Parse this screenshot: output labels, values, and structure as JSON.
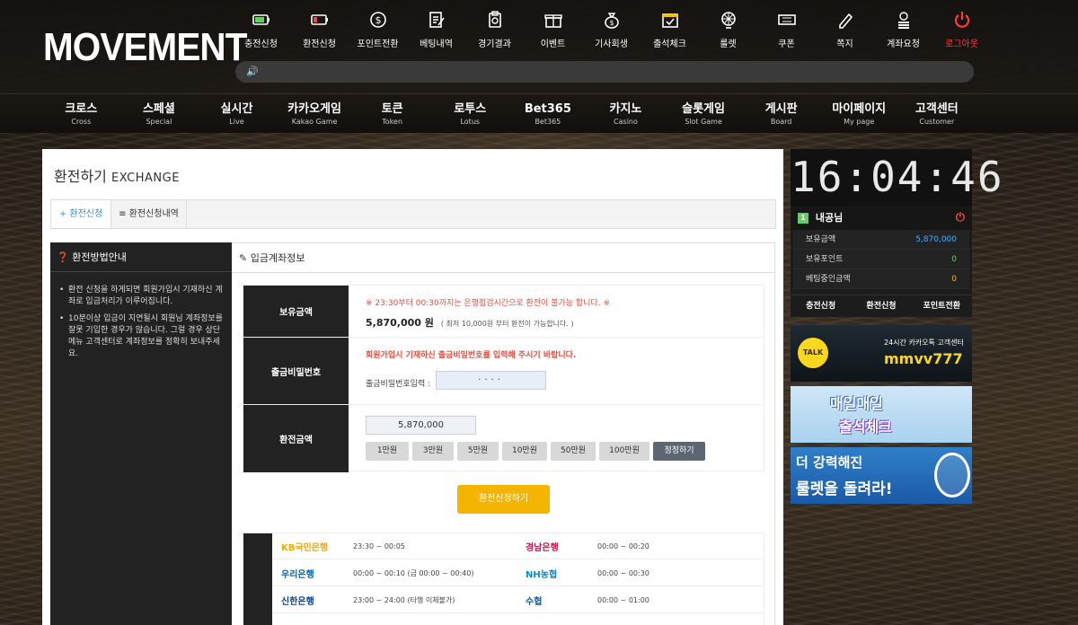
{
  "logo": "MOVEMENT",
  "top_menu": [
    {
      "label": "충전신청",
      "icon": "battery-charge-icon"
    },
    {
      "label": "환전신청",
      "icon": "battery-low-icon"
    },
    {
      "label": "포인트전환",
      "icon": "dollar-convert-icon"
    },
    {
      "label": "베팅내역",
      "icon": "edit-doc-icon"
    },
    {
      "label": "경기결과",
      "icon": "clipboard-icon"
    },
    {
      "label": "이벤트",
      "icon": "gift-icon"
    },
    {
      "label": "기사회생",
      "icon": "money-bag-icon"
    },
    {
      "label": "출석체크",
      "icon": "calendar-check-icon"
    },
    {
      "label": "룰렛",
      "icon": "roulette-icon"
    },
    {
      "label": "쿠폰",
      "icon": "ticket-icon"
    },
    {
      "label": "쪽지",
      "icon": "pen-note-icon"
    },
    {
      "label": "계좌요청",
      "icon": "coins-icon"
    },
    {
      "label": "로그아웃",
      "icon": "power-icon"
    }
  ],
  "notice_icon": "speaker-icon",
  "main_nav": [
    {
      "ko": "크로스",
      "en": "Cross"
    },
    {
      "ko": "스페셜",
      "en": "Special"
    },
    {
      "ko": "실시간",
      "en": "Live"
    },
    {
      "ko": "카카오게임",
      "en": "Kakao Game"
    },
    {
      "ko": "토큰",
      "en": "Token"
    },
    {
      "ko": "로투스",
      "en": "Lotus"
    },
    {
      "ko": "Bet365",
      "en": "Bet365"
    },
    {
      "ko": "카지노",
      "en": "Casino"
    },
    {
      "ko": "슬롯게임",
      "en": "Slot Game"
    },
    {
      "ko": "게시판",
      "en": "Board"
    },
    {
      "ko": "마이페이지",
      "en": "My page"
    },
    {
      "ko": "고객센터",
      "en": "Customer"
    }
  ],
  "page": {
    "title": "환전하기",
    "title_en": "EXCHANGE",
    "tabs": [
      "+ 환전신청",
      "≡ 환전신청내역"
    ]
  },
  "guide": {
    "title": "환전방법안내",
    "items": [
      "환전 신청을 하게되면 회원가입시 기재하신 계좌로 입금처리가 이루어집니다.",
      "10분이상 입금이 지연될시 회원님 계좌정보를 잘못 기입한 경우가 많습니다. 그럴 경우 상단메뉴 고객센터로 계좌정보를 정확히 보내주세요."
    ]
  },
  "info": {
    "title": "입금계좌정보",
    "balance_label": "보유금액",
    "warning": "※ 23:30부터 00:30까지는 은행점검시간으로 환전이 불가능 합니다. ※",
    "balance_value": "5,870,000 원",
    "balance_note": "( 최저 10,000원 부터 환전이 가능합니다. )",
    "password_label": "출금비밀번호",
    "password_warning": "회원가입시 기재하신 출금비밀번호를 입력해 주시기 바랍니다.",
    "password_input_label": "출금비밀번호입력 :",
    "password_value": "····",
    "amount_label": "환전금액",
    "amount_value": "5,870,000",
    "quick_buttons": [
      "1만원",
      "3만원",
      "5만원",
      "10만원",
      "50만원",
      "100만원",
      "정정하기"
    ],
    "submit": "환전신청하기"
  },
  "banks": [
    [
      {
        "name": "KB국민은행",
        "time": "23:30 ~ 00:05",
        "color": "#f2a900"
      },
      {
        "name": "경남은행",
        "time": "00:00 ~ 00:20",
        "color": "#d6114b"
      }
    ],
    [
      {
        "name": "우리은행",
        "time": "00:00 ~ 00:10 (금 00:00 ~ 00:40)",
        "color": "#0068b7"
      },
      {
        "name": "NH농협",
        "time": "00:00 ~ 00:30",
        "color": "#0a8bd6"
      }
    ],
    [
      {
        "name": "신한은행",
        "time": "23:00 ~ 24:00 (타행 이체불가)",
        "color": "#0046a0"
      },
      {
        "name": "수협",
        "time": "00:00 ~ 01:00",
        "color": "#0a5fb4"
      }
    ]
  ],
  "sidebar": {
    "clock": "16:04:46",
    "username": "내공님",
    "level_badge": "1",
    "rows": [
      {
        "label": "보유금액",
        "value": "5,870,000",
        "color": "#4aa8ff"
      },
      {
        "label": "보유포인트",
        "value": "0",
        "color": "#5ed45e"
      },
      {
        "label": "베팅중인금액",
        "value": "0",
        "color": "#f5c000"
      }
    ],
    "buttons": [
      "충전신청",
      "환전신청",
      "포인트전환"
    ],
    "banner1": {
      "talk": "TALK",
      "line1": "24시간 카카오톡 고객센터",
      "line2": "mmvv777"
    },
    "banner2": {
      "line1": "매일매일",
      "line2": "출석체크"
    },
    "banner3": {
      "line1": "더 강력해진",
      "line2": "룰렛을 돌려라!"
    }
  }
}
